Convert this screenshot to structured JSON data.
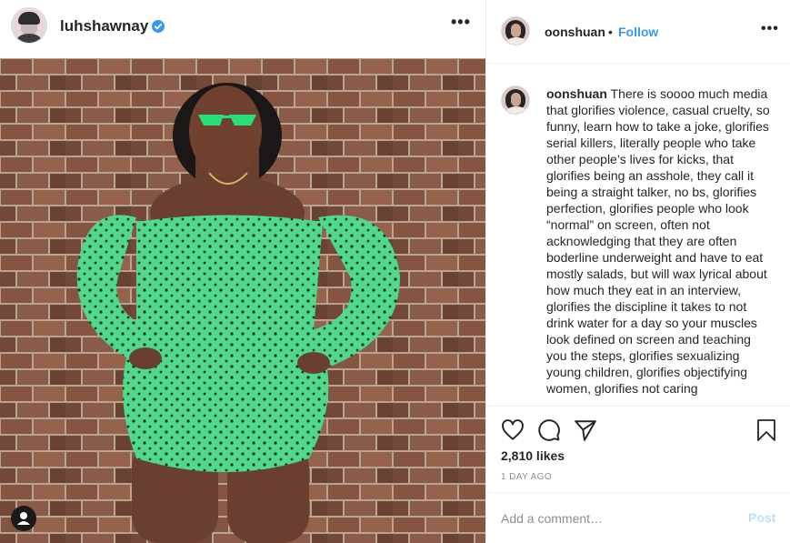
{
  "post": {
    "author": "luhshawnay",
    "verified": true,
    "more_options_label": "•••"
  },
  "panel": {
    "header_user": "oonshuan",
    "header_separator": "•",
    "follow_label": "Follow",
    "more_options_label": "•••"
  },
  "caption": {
    "username": "oonshuan",
    "text": "There is soooo much media that glorifies violence, casual cruelty, so funny, learn how to take a joke, glorifies serial killers, literally people who take other people’s lives for kicks, that glorifies being an asshole, they call it being a straight talker, no bs, glorifies perfection, glorifies people who look “normal” on screen, often not acknowledging that they are often boderline underweight and have to eat mostly salads, but will wax lyrical about how much they eat in an interview, glorifies the discipline it takes to not drink water for a day so your muscles look defined on screen and teaching you the steps, glorifies sexualizing young children, glorifies objectifying women, glorifies not caring"
  },
  "stats": {
    "likes": "2,810 likes",
    "time": "1 DAY AGO"
  },
  "comment": {
    "placeholder": "Add a comment…",
    "post_label": "Post"
  },
  "icons": {
    "like": "heart-icon",
    "comment": "comment-bubble-icon",
    "share": "paper-plane-icon",
    "save": "bookmark-icon",
    "verified": "verified-badge-icon",
    "tag": "user-tag-icon"
  },
  "colors": {
    "link_blue": "#3897f0",
    "post_disabled": "#b9dffc",
    "muted": "#8e8e8e",
    "text": "#262626",
    "dress_green": "#4fd98a",
    "brick": "#8a5a48"
  }
}
